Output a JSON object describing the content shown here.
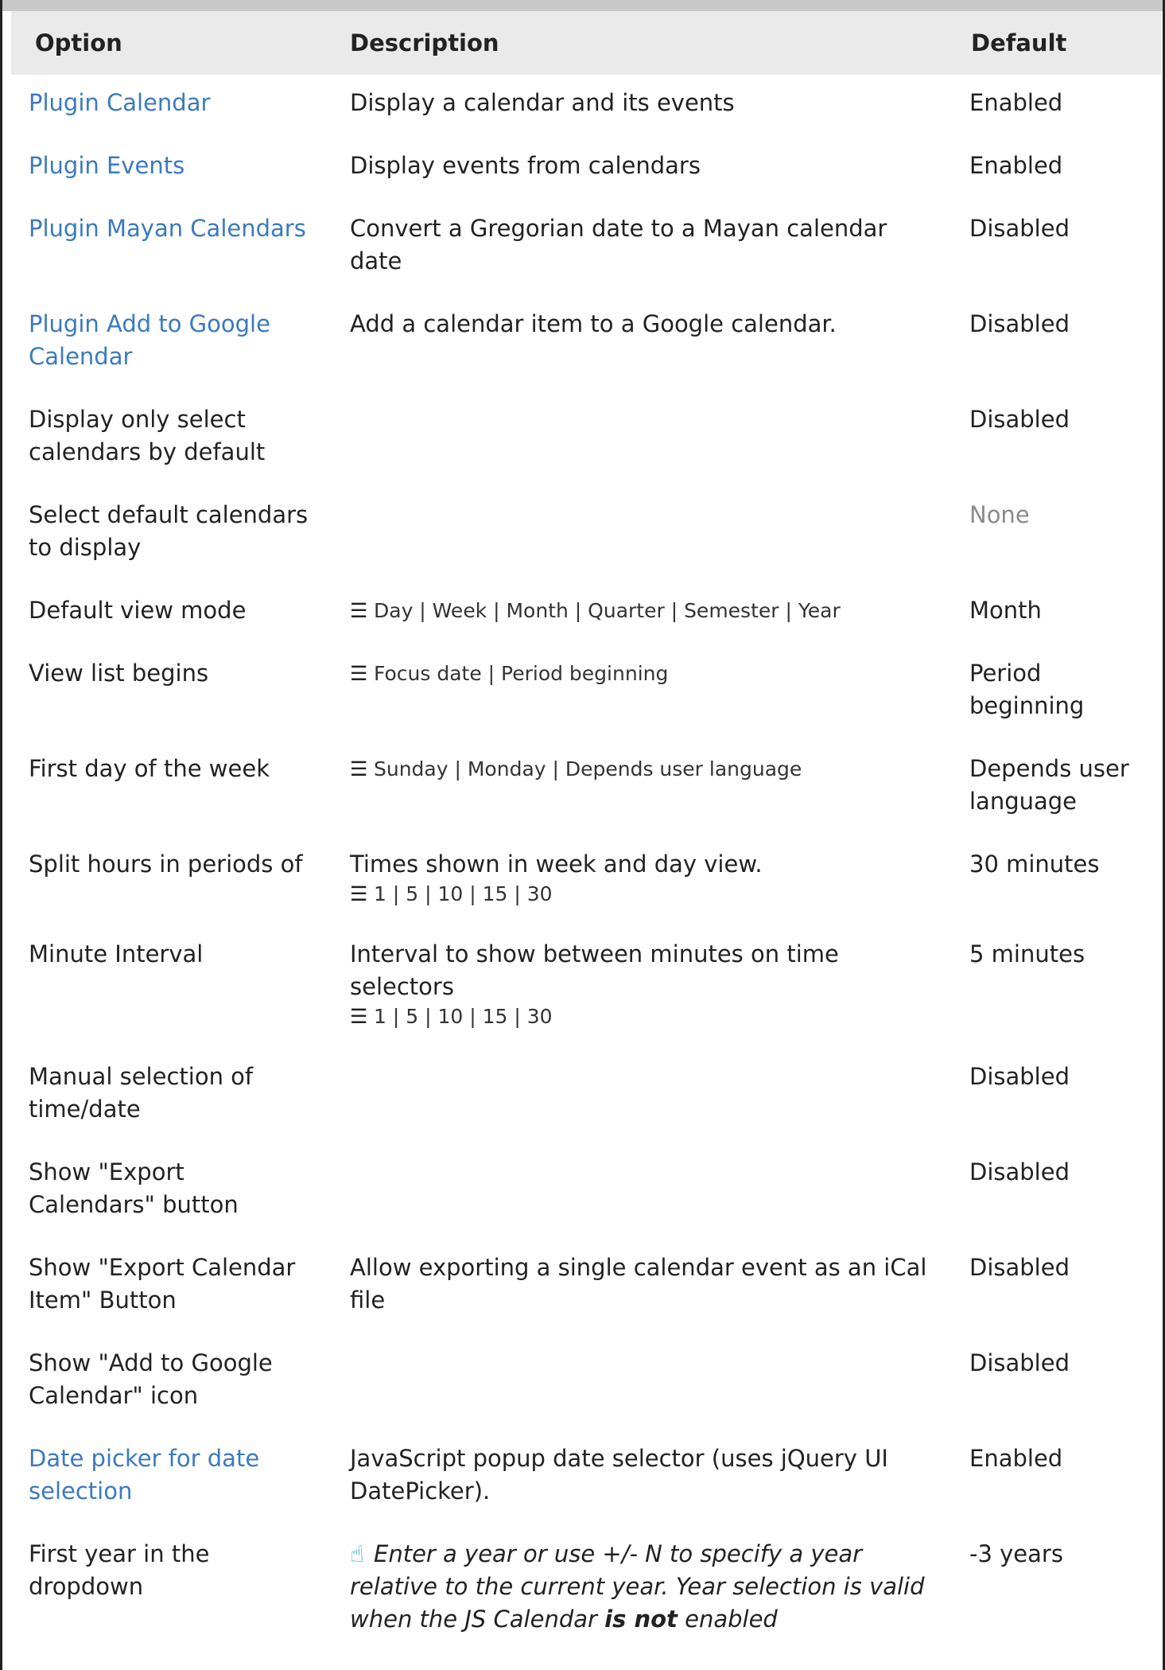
{
  "table": {
    "headers": [
      "Option",
      "Description",
      "Default"
    ],
    "rows": [
      {
        "option": "Plugin Calendar",
        "option_link": true,
        "description": "Display a calendar and its events",
        "options_list": "",
        "default": "Enabled",
        "default_muted": false
      },
      {
        "option": "Plugin Events",
        "option_link": true,
        "description": "Display events from calendars",
        "options_list": "",
        "default": "Enabled",
        "default_muted": false
      },
      {
        "option": "Plugin Mayan Calendars",
        "option_link": true,
        "description": "Convert a Gregorian date to a Mayan calendar date",
        "options_list": "",
        "default": "Disabled",
        "default_muted": false
      },
      {
        "option": "Plugin Add to Google Calendar",
        "option_link": true,
        "description": "Add a calendar item to a Google calendar.",
        "options_list": "",
        "default": "Disabled",
        "default_muted": false
      },
      {
        "option": "Display only select calendars by default",
        "option_link": false,
        "description": "",
        "options_list": "",
        "default": "Disabled",
        "default_muted": false
      },
      {
        "option": "Select default calendars to display",
        "option_link": false,
        "description": "",
        "options_list": "",
        "default": "None",
        "default_muted": true
      },
      {
        "option": "Default view mode",
        "option_link": false,
        "description": "",
        "options_list": "Day | Week | Month | Quarter | Semester | Year",
        "default": "Month",
        "default_muted": false
      },
      {
        "option": "View list begins",
        "option_link": false,
        "description": "",
        "options_list": "Focus date | Period beginning",
        "default": "Period beginning",
        "default_muted": false
      },
      {
        "option": "First day of the week",
        "option_link": false,
        "description": "",
        "options_list": "Sunday | Monday | Depends user language",
        "default": "Depends user language",
        "default_muted": false
      },
      {
        "option": "Split hours in periods of",
        "option_link": false,
        "description": "Times shown in week and day view.",
        "options_list": "1 | 5 | 10 | 15 | 30",
        "default": "30 minutes",
        "default_muted": false
      },
      {
        "option": "Minute Interval",
        "option_link": false,
        "description": "Interval to show between minutes on time selectors",
        "options_list": "1 | 5 | 10 | 15 | 30",
        "default": "5 minutes",
        "default_muted": false
      },
      {
        "option": "Manual selection of time/date",
        "option_link": false,
        "description": "",
        "options_list": "",
        "default": "Disabled",
        "default_muted": false
      },
      {
        "option": "Show \"Export Calendars\" button",
        "option_link": false,
        "description": "",
        "options_list": "",
        "default": "Disabled",
        "default_muted": false
      },
      {
        "option": "Show \"Export Calendar Item\" Button",
        "option_link": false,
        "description": "Allow exporting a single calendar event as an iCal file",
        "options_list": "",
        "default": "Disabled",
        "default_muted": false
      },
      {
        "option": "Show \"Add to Google Calendar\" icon",
        "option_link": false,
        "description": "",
        "options_list": "",
        "default": "Disabled",
        "default_muted": false
      },
      {
        "option": "Date picker for date selection",
        "option_link": true,
        "description": "JavaScript popup date selector (uses jQuery UI DatePicker).",
        "options_list": "",
        "default": "Enabled",
        "default_muted": false
      }
    ],
    "last_row": {
      "option": "First year in the dropdown",
      "help_before": "Enter a year or use +/- N to specify a year relative to the current year. Year selection is valid when the JS Calendar ",
      "help_bold": "is not",
      "help_after": " enabled",
      "default": "-3 years"
    }
  },
  "icons": {
    "list_icon": "list-icon",
    "hand_icon": "pointing-hand-icon"
  },
  "colors": {
    "link": "#3a7abf",
    "header_bg": "#eaeaea",
    "muted": "#8a8a8a",
    "help_icon": "#2aa6c8"
  }
}
